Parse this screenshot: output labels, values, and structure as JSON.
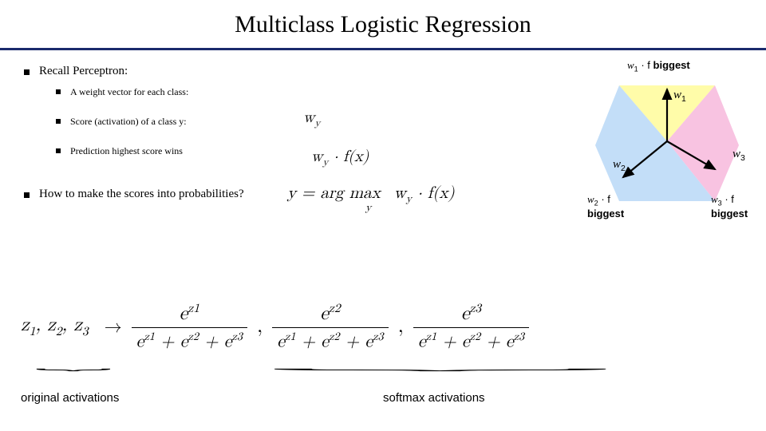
{
  "title": "Multiclass Logistic Regression",
  "bullets": {
    "recall": "Recall Perceptron:",
    "sub1": "A weight vector for each class:",
    "sub2": "Score (activation) of a class y:",
    "sub3": "Prediction highest score wins",
    "howto": "How to make the scores into probabilities?"
  },
  "math": {
    "wy": "w",
    "wy_sub": "y",
    "score": "w",
    "score_sub": "y",
    "score_dot": " · f(x)",
    "argmax_y": "y = arg max",
    "argmax_sub": "y",
    "argmax_wf": "w",
    "argmax_wfsub": "y",
    "argmax_rest": " · f(x)"
  },
  "softmax": {
    "z_left": "z",
    "z1": "1",
    "z2": "2",
    "z3": "3",
    "e": "e",
    "arrow": "→"
  },
  "labels": {
    "orig": "original activations",
    "soft": "softmax activations"
  },
  "diagram": {
    "w1f": "w",
    "w1f_sub": "1",
    "w1f_txt": " · f ",
    "biggest": "biggest",
    "w1": "w",
    "w1_sub": "1",
    "w2": "w",
    "w2_sub": "2",
    "w3": "w",
    "w3_sub": "3",
    "w2f": "w",
    "w2f_sub": "2",
    "w2f_txt": " · f",
    "w3f": "w",
    "w3f_sub": "3",
    "w3f_txt": " · f"
  }
}
